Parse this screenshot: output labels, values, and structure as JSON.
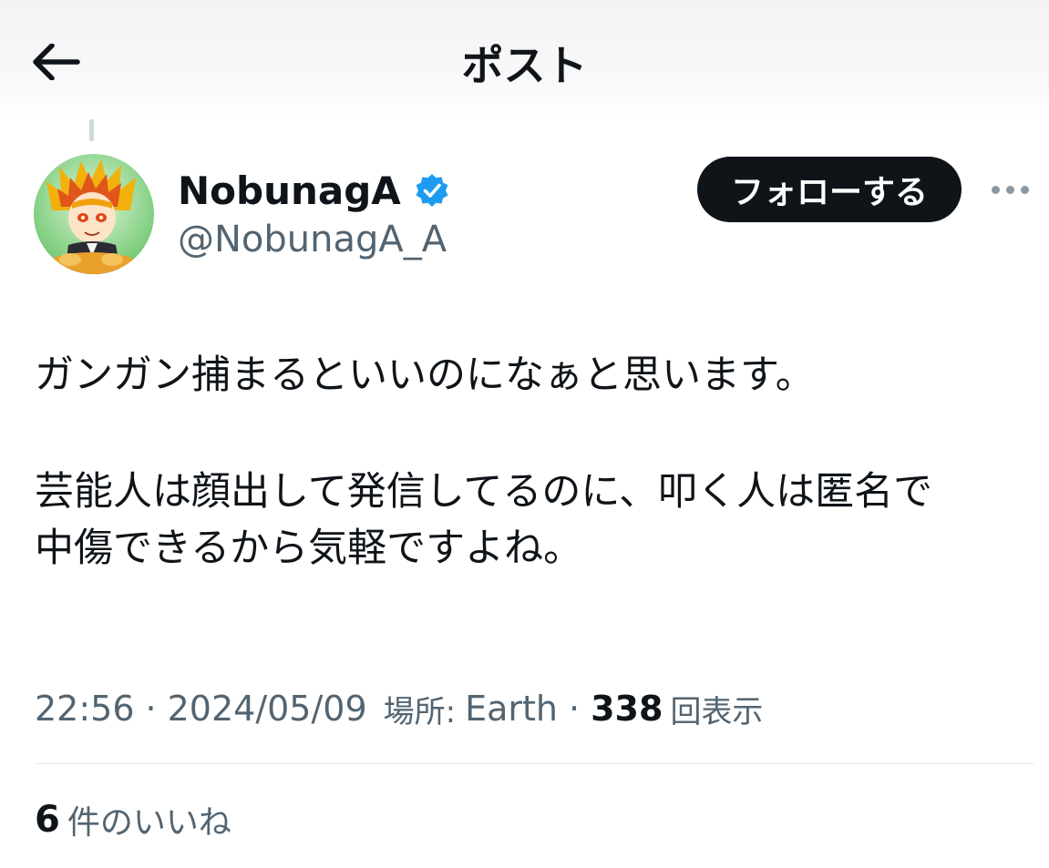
{
  "header": {
    "title": "ポスト",
    "back_icon": "arrow-left-icon"
  },
  "author": {
    "display_name": "NobunagA",
    "handle": "@NobunagA_A",
    "verified_icon": "verified-badge-icon",
    "verified_color": "#1d9bf0",
    "avatar": "avatar"
  },
  "actions": {
    "follow_label": "フォローする",
    "more_icon": "more-dots-icon"
  },
  "post": {
    "lines": [
      "ガンガン捕まるといいのになぁと思います。",
      "芸能人は顔出して発信してるのに、叩く人は匿名で",
      "中傷できるから気軽ですよね。"
    ]
  },
  "meta": {
    "time": "22:56",
    "separator": "·",
    "date": "2024/05/09",
    "location_label": "場所:",
    "location": "Earth",
    "views_count": "338",
    "views_label": "回表示"
  },
  "engagement": {
    "likes_count": "6",
    "likes_label": "件のいいね"
  },
  "colors": {
    "text_primary": "#0f1419",
    "text_secondary": "#536471",
    "follow_bg": "#0f1419",
    "divider": "#e1e8ed"
  }
}
